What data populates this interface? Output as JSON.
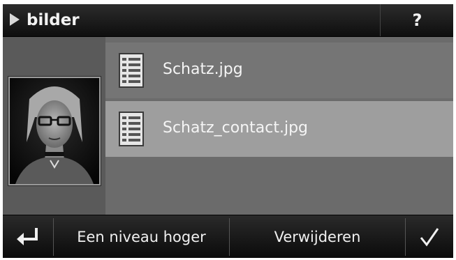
{
  "header": {
    "title": "bilder",
    "help_label": "?"
  },
  "files": [
    {
      "name": "Schatz.jpg",
      "icon": "document-icon",
      "selected": false
    },
    {
      "name": "Schatz_contact.jpg",
      "icon": "document-icon",
      "selected": true
    }
  ],
  "toolbar": {
    "back_icon": "return-arrow-icon",
    "up_label": "Een niveau hoger",
    "delete_label": "Verwijderen",
    "ok_icon": "checkmark-icon"
  },
  "colors": {
    "titlebar": "#111111",
    "list_background": "#6b6b6b",
    "row_normal": "#757575",
    "row_selected": "#9e9e9e",
    "text": "#f5f5f5"
  }
}
